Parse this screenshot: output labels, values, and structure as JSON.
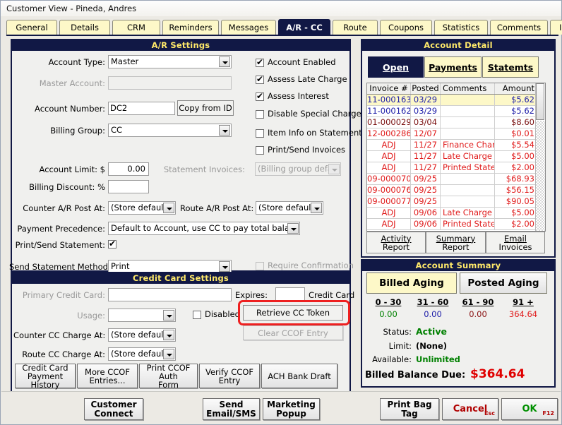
{
  "window": {
    "title": "Customer View - Pineda, Andres"
  },
  "tabs": [
    {
      "label": "General",
      "active": false
    },
    {
      "label": "Details",
      "active": false
    },
    {
      "label": "CRM",
      "active": false
    },
    {
      "label": "Reminders",
      "active": false
    },
    {
      "label": "Messages",
      "active": false
    },
    {
      "label": "A/R - CC",
      "active": true
    },
    {
      "label": "Route",
      "active": false
    },
    {
      "label": "Coupons",
      "active": false
    },
    {
      "label": "Statistics",
      "active": false
    },
    {
      "label": "Comments",
      "active": false
    },
    {
      "label": "Issues",
      "active": false
    }
  ],
  "ar_settings": {
    "title": "A/R Settings",
    "account_type_label": "Account Type:",
    "account_type_value": "Master",
    "master_account_label": "Master Account:",
    "master_account_value": "",
    "account_number_label": "Account Number:",
    "account_number_value": "DC2",
    "copy_from_id_label": "Copy from ID",
    "billing_group_label": "Billing Group:",
    "billing_group_value": "CC",
    "account_limit_label": "Account Limit: $",
    "account_limit_value": "0.00",
    "billing_discount_label": "Billing Discount: %",
    "billing_discount_value": "",
    "counter_ar_post_label": "Counter A/R Post At:",
    "counter_ar_post_value": "(Store default)",
    "route_ar_post_label": "Route A/R Post At:",
    "route_ar_post_value": "(Store default)",
    "payment_precedence_label": "Payment Precedence:",
    "payment_precedence_value": "Default to Account, use CC to pay total balance",
    "print_send_statement_label": "Print/Send Statement:",
    "send_statement_method_label": "Send Statement Method:",
    "send_statement_method_value": "Print",
    "require_confirmation_label": "Require Confirmation",
    "statement_invoices_label": "Statement Invoices:",
    "statement_invoices_value": "(Billing group default)",
    "checkboxes": [
      {
        "label": "Account Enabled",
        "checked": true,
        "disabled": false
      },
      {
        "label": "Assess Late Charge",
        "checked": true,
        "disabled": false
      },
      {
        "label": "Assess Interest",
        "checked": true,
        "disabled": false
      },
      {
        "label": "Disable Special Charge",
        "checked": false,
        "disabled": false
      },
      {
        "label": "Item Info on Statement",
        "checked": false,
        "disabled": false
      },
      {
        "label": "Print/Send Invoices",
        "checked": false,
        "disabled": false
      }
    ]
  },
  "cc_settings": {
    "title": "Credit Card Settings",
    "primary_credit_card_label": "Primary Credit Card:",
    "primary_credit_card_value": "",
    "expires_label": "Expires:",
    "expires_value": "",
    "credit_card_text": "Credit Card",
    "usage_label": "Usage:",
    "usage_value": "",
    "disabled_label": "Disabled",
    "retrieve_token_label": "Retrieve CC Token",
    "clear_ccof_label": "Clear CCOF Entry",
    "counter_cc_charge_label": "Counter CC Charge At:",
    "counter_cc_charge_value": "(Store default)",
    "route_cc_charge_label": "Route CC Charge At:",
    "route_cc_charge_value": "(Store default)",
    "buttons": [
      {
        "line1": "Credit Card",
        "line2": "Payment History"
      },
      {
        "line1": "More CCOF",
        "line2": "Entries..."
      },
      {
        "line1": "Print CCOF Auth",
        "line2": "Form"
      },
      {
        "line1": "Verify CCOF",
        "line2": "Entry"
      },
      {
        "line1": "ACH Bank Draft",
        "line2": ""
      }
    ]
  },
  "account_detail": {
    "title": "Account Detail",
    "subtabs": [
      {
        "label": "Open",
        "active": true
      },
      {
        "label": "Payments",
        "active": false
      },
      {
        "label": "Statemts",
        "active": false
      }
    ],
    "columns": [
      "Invoice #",
      "Posted",
      "Comments",
      "Amount"
    ],
    "rows": [
      {
        "invoice": "11-000163",
        "posted": "03/29",
        "comments": "",
        "amount": "$5.62",
        "color": "blue",
        "selected": true
      },
      {
        "invoice": "11-000162",
        "posted": "03/29",
        "comments": "",
        "amount": "$5.62",
        "color": "blue",
        "selected": false
      },
      {
        "invoice": "01-000029",
        "posted": "03/04",
        "comments": "",
        "amount": "$8.60",
        "color": "maroon",
        "selected": false
      },
      {
        "invoice": "12-000286",
        "posted": "12/07",
        "comments": "",
        "amount": "$0.01",
        "color": "red",
        "selected": false
      },
      {
        "invoice": "ADJ",
        "posted": "11/27",
        "comments": "Finance Charge",
        "amount": "$5.54",
        "color": "red",
        "selected": false
      },
      {
        "invoice": "ADJ",
        "posted": "11/27",
        "comments": "Late Charge",
        "amount": "$5.00",
        "color": "red",
        "selected": false
      },
      {
        "invoice": "ADJ",
        "posted": "11/27",
        "comments": "Printed Statemt",
        "amount": "$2.00",
        "color": "red",
        "selected": false
      },
      {
        "invoice": "09-000070",
        "posted": "09/25",
        "comments": "",
        "amount": "$68.93",
        "color": "red",
        "selected": false
      },
      {
        "invoice": "09-000076",
        "posted": "09/25",
        "comments": "",
        "amount": "$56.15",
        "color": "red",
        "selected": false
      },
      {
        "invoice": "09-000077",
        "posted": "09/25",
        "comments": "",
        "amount": "$90.05",
        "color": "red",
        "selected": false
      },
      {
        "invoice": "ADJ",
        "posted": "09/06",
        "comments": "Late Charge",
        "amount": "$5.00",
        "color": "red",
        "selected": false
      },
      {
        "invoice": "ADJ",
        "posted": "09/06",
        "comments": "Printed Statemt",
        "amount": "$2.00",
        "color": "red",
        "selected": false
      }
    ],
    "footer_buttons": [
      {
        "line1": "Activity",
        "line2": "Report"
      },
      {
        "line1": "Summary",
        "line2": "Report"
      },
      {
        "line1": "Email",
        "line2": "Invoices"
      }
    ]
  },
  "account_summary": {
    "title": "Account Summary",
    "tabs": [
      {
        "label": "Billed Aging",
        "active": true
      },
      {
        "label": "Posted Aging",
        "active": false
      }
    ],
    "aging_headers": [
      "0 - 30",
      "31 - 60",
      "61 - 90",
      "91 +"
    ],
    "aging_values": [
      "0.00",
      "0.00",
      "0.00",
      "364.64"
    ],
    "status_label": "Status:",
    "status_value": "Active",
    "limit_label": "Limit:",
    "limit_value": "(None)",
    "available_label": "Available:",
    "available_value": "Unlimited",
    "balance_label": "Billed Balance Due:",
    "balance_value": "$364.64"
  },
  "bottom_bar": {
    "customer_connect": {
      "line1": "Customer",
      "line2": "Connect"
    },
    "send_email": {
      "line1": "Send",
      "line2": "Email/SMS"
    },
    "marketing": {
      "line1": "Marketing",
      "line2": "Popup"
    },
    "print_bag_tag": {
      "line1": "Print Bag",
      "line2": "Tag"
    },
    "cancel": {
      "label": "Cancel",
      "key": "Esc"
    },
    "ok": {
      "label": "OK",
      "key": "F12"
    }
  },
  "colors": {
    "accent_navy": "#111845",
    "tab_yellow": "#fdf8c8",
    "highlight_red": "#ee2020",
    "balance_red": "#e00000",
    "status_green": "#008000"
  }
}
